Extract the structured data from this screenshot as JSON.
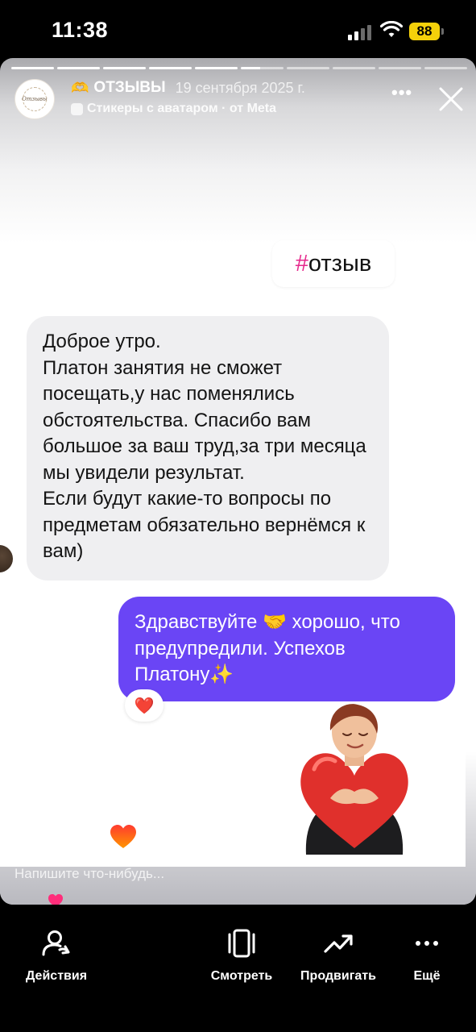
{
  "status_bar": {
    "time": "11:38",
    "battery": "88"
  },
  "story": {
    "progress": {
      "total_segments": 10,
      "current_index": 5
    },
    "author": "ОТЗЫВЫ",
    "date": "19 сентября 2025 г.",
    "subtitle": "Стикеры с аватаром · от Meta",
    "avatar_text": "Отзывы",
    "hashtag": {
      "symbol": "#",
      "word": "отзыв"
    }
  },
  "chat": {
    "incoming": [
      "Доброе утро.",
      "Платон занятия не сможет посещать,у нас поменялись обстоятельства. Спасибо вам большое за ваш труд,за три месяца мы увидели результат.",
      "Если будут какие-то вопросы по предметам обязательно вернёмся к вам)"
    ],
    "outgoing": "Здравствуйте 🤝 хорошо, что предупредили. Успехов Платону✨",
    "reaction": "❤️"
  },
  "reply_placeholder": "Напишите что-нибудь...",
  "actions": [
    {
      "label": "Действия",
      "icon": "person-icon"
    },
    {
      "label": "Смотреть",
      "icon": "carousel-icon"
    },
    {
      "label": "Продвигать",
      "icon": "trend-up-icon"
    },
    {
      "label": "Ещё",
      "icon": "more-icon"
    }
  ],
  "colors": {
    "accent_purple": "#6a45f5",
    "hashtag_pink": "#e6288c",
    "battery": "#f5d10a"
  }
}
